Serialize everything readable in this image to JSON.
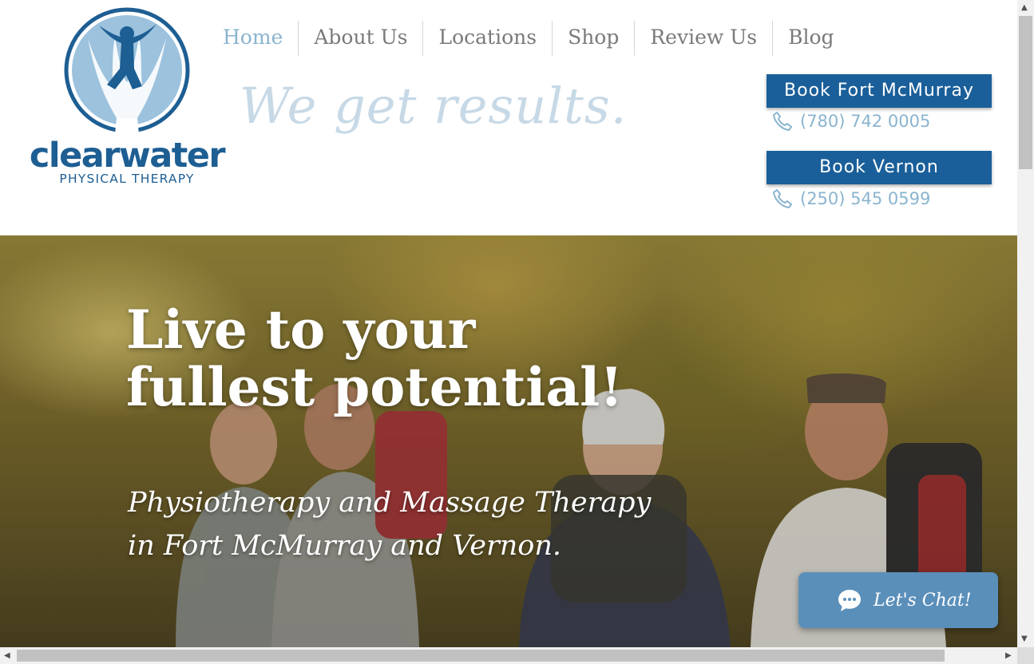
{
  "brand": {
    "name": "clearwater",
    "subtitle": "PHYSICAL THERAPY",
    "primary_color": "#1d5e93",
    "accent_color": "#8ab4cf"
  },
  "nav": {
    "items": [
      {
        "label": "Home",
        "active": true
      },
      {
        "label": "About Us"
      },
      {
        "label": "Locations"
      },
      {
        "label": "Shop"
      },
      {
        "label": "Review Us"
      },
      {
        "label": "Blog"
      }
    ]
  },
  "tagline": "We get results.",
  "booking": [
    {
      "button_label": "Book Fort McMurray",
      "phone": "(780) 742 0005",
      "icon": "phone-icon"
    },
    {
      "button_label": "Book Vernon",
      "phone": "(250) 545 0599",
      "icon": "phone-icon"
    }
  ],
  "hero": {
    "title_line1": "Live to your",
    "title_line2": "fullest potential!",
    "subtitle_line1": "Physiotherapy and Massage Therapy",
    "subtitle_line2": "in Fort McMurray and Vernon."
  },
  "chat": {
    "label": "Let's Chat!",
    "icon": "chat-bubble-icon"
  }
}
